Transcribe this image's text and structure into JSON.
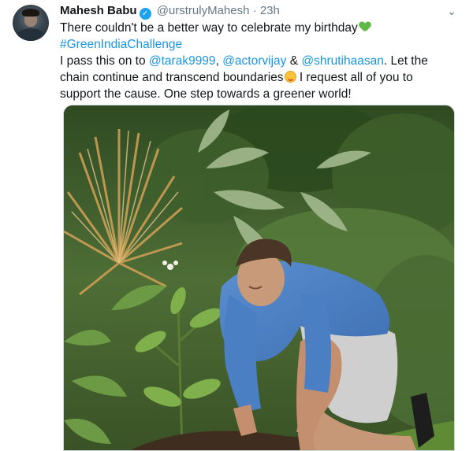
{
  "tweet": {
    "author_name": "Mahesh Babu",
    "verified_symbol": "✓",
    "handle": "@urstrulyMahesh",
    "separator": "·",
    "timestamp": "23h",
    "caret_symbol": "⌄",
    "line1": "There couldn't be a better way to celebrate my birthday",
    "hashtag": "#GreenIndiaChallenge",
    "pass_text": "I pass this on to ",
    "mention1": "@tarak9999",
    "comma": ", ",
    "mention2": "@actorvijay",
    "amp": " & ",
    "mention3": "@shrutihaasan",
    "after_mentions": ". Let the chain continue and transcend boundaries",
    "closing": " I request all of you to support the cause. One step towards a greener world!"
  },
  "colors": {
    "link": "#1b95e0",
    "muted": "#657786",
    "verified_badge": "#1da1f2"
  },
  "icons": {
    "verified": "verified-badge-icon",
    "menu": "chevron-down-icon",
    "heart": "green-heart-emoji",
    "smile": "smiling-face-emoji"
  }
}
